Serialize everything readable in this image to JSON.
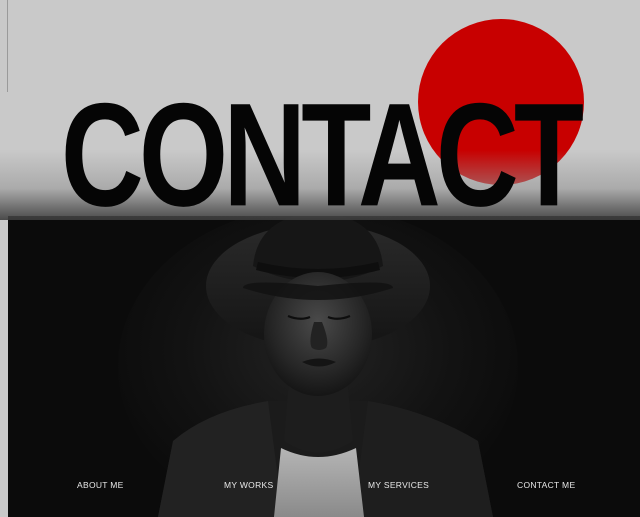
{
  "hero": {
    "headline": "CONTACT"
  },
  "nav": {
    "items": [
      {
        "label": "ABOUT ME"
      },
      {
        "label": "MY WORKS"
      },
      {
        "label": "MY SERVICES"
      },
      {
        "label": "CONTACT ME"
      }
    ]
  },
  "colors": {
    "background": "#c9c9c9",
    "accent_circle": "#c80000",
    "headline": "#050505",
    "panel": "#0b0b0b",
    "nav_text": "#e8e8e8"
  }
}
